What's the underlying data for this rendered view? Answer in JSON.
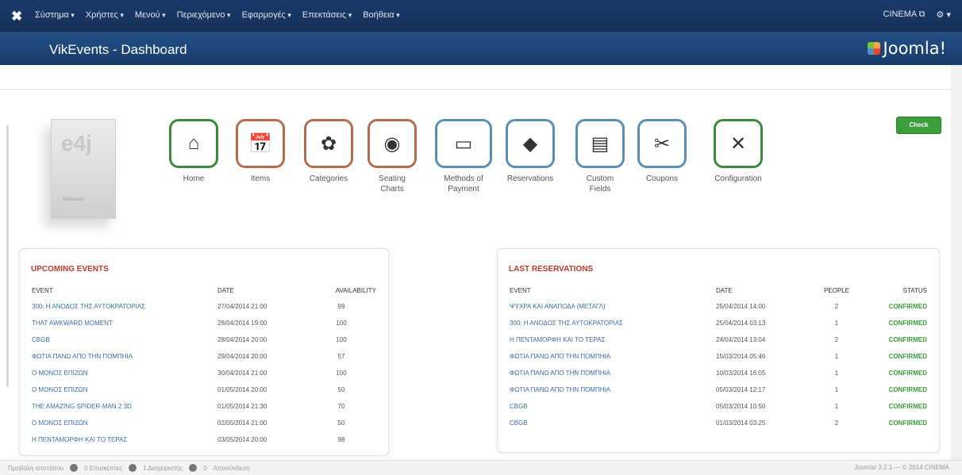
{
  "topbar": {
    "menu": [
      "Σύστημα",
      "Χρήστες",
      "Μενού",
      "Περιεχόμενο",
      "Εφαρμογές",
      "Επεκτάσεις",
      "Βοήθεια"
    ],
    "site": "CINEMA",
    "gear": "gear-icon"
  },
  "subbar": {
    "title": "VikEvents - Dashboard",
    "brand": "Joomla!"
  },
  "check_updates": "Check Updates",
  "product_box": {
    "logo": "e4j",
    "label": "VikEvents"
  },
  "icons": [
    {
      "label": "Home",
      "icon": "home-icon",
      "glyph": "⌂",
      "color": "green"
    },
    {
      "label": "Items",
      "icon": "calendar-icon",
      "glyph": "📅",
      "color": "brown"
    },
    {
      "label": "Categories",
      "icon": "categories-icon",
      "glyph": "✿",
      "color": "brown"
    },
    {
      "label": "Seating Charts",
      "icon": "seating-icon",
      "glyph": "◉",
      "color": "brown"
    },
    {
      "label": "Methods of Payment",
      "icon": "payment-icon",
      "glyph": "▭",
      "color": "blue"
    },
    {
      "label": "Reservations",
      "icon": "tag-icon",
      "glyph": "◆",
      "color": "blue"
    },
    {
      "label": "Custom Fields",
      "icon": "fields-icon",
      "glyph": "▤",
      "color": "blue"
    },
    {
      "label": "Coupons",
      "icon": "scissors-icon",
      "glyph": "✂",
      "color": "blue"
    },
    {
      "label": "Configuration",
      "icon": "tools-icon",
      "glyph": "✕",
      "color": "green"
    }
  ],
  "upcoming": {
    "title": "UPCOMING EVENTS",
    "headers": [
      "EVENT",
      "DATE",
      "AVAILABILITY"
    ],
    "rows": [
      [
        "300: Η ΑΝΟΔΟΣ ΤΗΣ ΑΥΤΟΚΡΑΤΟΡΙΑΣ",
        "27/04/2014 21:00",
        "99"
      ],
      [
        "THAT AWKWARD MOMENT",
        "28/04/2014 19:00",
        "100"
      ],
      [
        "CBGB",
        "28/04/2014 20:00",
        "100"
      ],
      [
        "ΦΩΤΙΑ ΠΑΝΩ ΑΠΟ ΤΗΝ ΠΟΜΠΗΙΑ",
        "29/04/2014 20:00",
        "57"
      ],
      [
        "Ο ΜΟΝΟΣ ΕΠΙΖΩΝ",
        "30/04/2014 21:00",
        "100"
      ],
      [
        "Ο ΜΟΝΟΣ ΕΠΙΖΩΝ",
        "01/05/2014 20:00",
        "50"
      ],
      [
        "THE AMAZING SPIDER-MAN 2 3D",
        "01/05/2014 21:30",
        "70"
      ],
      [
        "Ο ΜΟΝΟΣ ΕΠΙΖΩΝ",
        "02/05/2014 21:00",
        "50"
      ],
      [
        "Η ΠΕΝΤΑΜΟΡΦΗ ΚΑΙ ΤΟ ΤΕΡΑΣ",
        "03/05/2014 20:00",
        "98"
      ]
    ]
  },
  "reservations": {
    "title": "LAST RESERVATIONS",
    "headers": [
      "EVENT",
      "DATE",
      "PEOPLE",
      "STATUS"
    ],
    "rows": [
      [
        "ΨΥΧΡΑ ΚΑΙ ΑΝΑΠΟΔΑ (ΜΕΤΑΓΛ)",
        "25/04/2014 14:00",
        "2",
        "CONFIRMED"
      ],
      [
        "300: Η ΑΝΟΔΟΣ ΤΗΣ ΑΥΤΟΚΡΑΤΟΡΙΑΣ",
        "25/04/2014 03:13",
        "1",
        "CONFIRMED"
      ],
      [
        "Η ΠΕΝΤΑΜΟΡΦΗ ΚΑΙ ΤΟ ΤΕΡΑΣ",
        "24/04/2014 13:04",
        "2",
        "CONFIRMED"
      ],
      [
        "ΦΩΤΙΑ ΠΑΝΩ ΑΠΟ ΤΗΝ ΠΟΜΠΗΙΑ",
        "15/03/2014 05:46",
        "1",
        "CONFIRMED"
      ],
      [
        "ΦΩΤΙΑ ΠΑΝΩ ΑΠΟ ΤΗΝ ΠΟΜΠΗΙΑ",
        "10/03/2014 16:05",
        "1",
        "CONFIRMED"
      ],
      [
        "ΦΩΤΙΑ ΠΑΝΩ ΑΠΟ ΤΗΝ ΠΟΜΠΗΙΑ",
        "05/03/2014 12:17",
        "1",
        "CONFIRMED"
      ],
      [
        "CBGB",
        "05/03/2014 10:50",
        "1",
        "CONFIRMED"
      ],
      [
        "CBGB",
        "01/03/2014 03:25",
        "2",
        "CONFIRMED"
      ]
    ]
  },
  "footer": {
    "left": [
      "Προβολή ιστοτόπου",
      "0 Επισκέπτες",
      "1 Διαχειριστής",
      "0",
      "Αποσύνδεση"
    ],
    "right": "Joomla! 3.2.1 — © 2014 CINEMA"
  }
}
